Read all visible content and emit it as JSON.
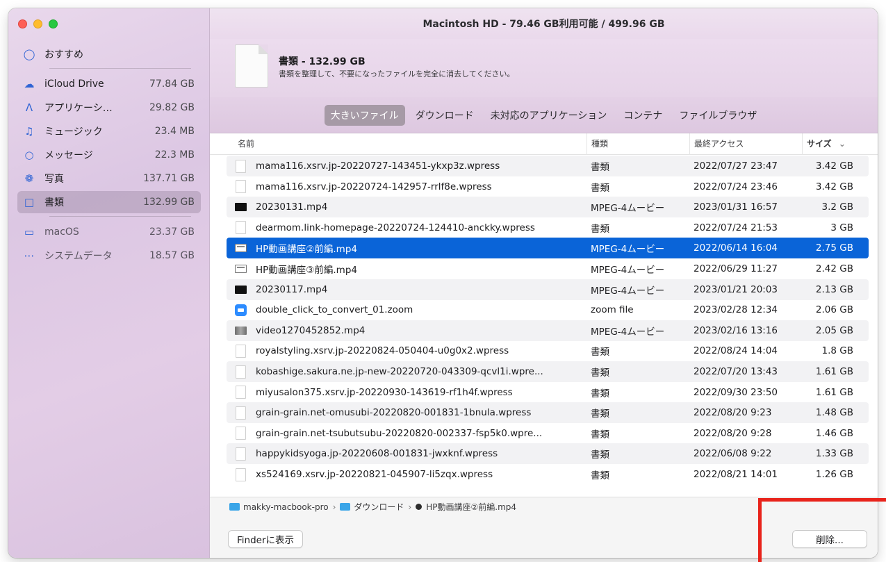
{
  "window": {
    "title": "Macintosh HD - 79.46 GB利用可能 / 499.96 GB"
  },
  "sidebar": {
    "items": [
      {
        "icon": "lightbulb-icon",
        "label": "おすすめ",
        "size": ""
      },
      {
        "icon": "cloud-icon",
        "label": "iCloud Drive",
        "size": "77.84 GB"
      },
      {
        "icon": "apps-icon",
        "label": "アプリケーシ…",
        "size": "29.82 GB"
      },
      {
        "icon": "music-note-icon",
        "label": "ミュージック",
        "size": "23.4 MB"
      },
      {
        "icon": "message-bubble-icon",
        "label": "メッセージ",
        "size": "22.3 MB"
      },
      {
        "icon": "photos-flower-icon",
        "label": "写真",
        "size": "137.71 GB"
      },
      {
        "icon": "document-icon",
        "label": "書類",
        "size": "132.99 GB"
      },
      {
        "icon": "laptop-icon",
        "label": "macOS",
        "size": "23.37 GB"
      },
      {
        "icon": "ellipsis-icon",
        "label": "システムデータ",
        "size": "18.57 GB"
      }
    ]
  },
  "header": {
    "title": "書類 - 132.99 GB",
    "description": "書類を整理して、不要になったファイルを完全に消去してください。"
  },
  "tabs": [
    {
      "label": "大きいファイル",
      "active": true
    },
    {
      "label": "ダウンロード",
      "active": false
    },
    {
      "label": "未対応のアプリケーション",
      "active": false
    },
    {
      "label": "コンテナ",
      "active": false
    },
    {
      "label": "ファイルブラウザ",
      "active": false
    }
  ],
  "table": {
    "columns": {
      "name": "名前",
      "kind": "種類",
      "last_access": "最終アクセス",
      "size": "サイズ"
    },
    "sort_indicator": "⌄",
    "rows": [
      {
        "icon": "doc",
        "name": "mama116.xsrv.jp-20220727-143451-ykxp3z.wpress",
        "kind": "書類",
        "date": "2022/07/27 23:47",
        "size": "3.42 GB"
      },
      {
        "icon": "doc",
        "name": "mama116.xsrv.jp-20220724-142957-rrlf8e.wpress",
        "kind": "書類",
        "date": "2022/07/24 23:46",
        "size": "3.42 GB"
      },
      {
        "icon": "video",
        "name": "20230131.mp4",
        "kind": "MPEG-4ムービー",
        "date": "2023/01/31 16:57",
        "size": "3.2 GB"
      },
      {
        "icon": "doc",
        "name": "dearmom.link-homepage-20220724-124410-anckky.wpress",
        "kind": "書類",
        "date": "2022/07/24 21:53",
        "size": "3 GB"
      },
      {
        "icon": "video-light",
        "name": "HP動画講座②前編.mp4",
        "kind": "MPEG-4ムービー",
        "date": "2022/06/14 16:04",
        "size": "2.75 GB",
        "selected": true
      },
      {
        "icon": "video-light",
        "name": "HP動画講座③前編.mp4",
        "kind": "MPEG-4ムービー",
        "date": "2022/06/29 11:27",
        "size": "2.42 GB"
      },
      {
        "icon": "video",
        "name": "20230117.mp4",
        "kind": "MPEG-4ムービー",
        "date": "2023/01/21 20:03",
        "size": "2.13 GB"
      },
      {
        "icon": "zoom",
        "name": "double_click_to_convert_01.zoom",
        "kind": "zoom file",
        "date": "2023/02/28 12:34",
        "size": "2.06 GB"
      },
      {
        "icon": "video-gray",
        "name": "video1270452852.mp4",
        "kind": "MPEG-4ムービー",
        "date": "2023/02/16 13:16",
        "size": "2.05 GB"
      },
      {
        "icon": "doc",
        "name": "royalstyling.xsrv.jp-20220824-050404-u0g0x2.wpress",
        "kind": "書類",
        "date": "2022/08/24 14:04",
        "size": "1.8 GB"
      },
      {
        "icon": "doc",
        "name": "kobashige.sakura.ne.jp-new-20220720-043309-qcvl1i.wpre...",
        "kind": "書類",
        "date": "2022/07/20 13:43",
        "size": "1.61 GB"
      },
      {
        "icon": "doc",
        "name": "miyusalon375.xsrv.jp-20220930-143619-rf1h4f.wpress",
        "kind": "書類",
        "date": "2022/09/30 23:50",
        "size": "1.61 GB"
      },
      {
        "icon": "doc",
        "name": "grain-grain.net-omusubi-20220820-001831-1bnula.wpress",
        "kind": "書類",
        "date": "2022/08/20 9:23",
        "size": "1.48 GB"
      },
      {
        "icon": "doc",
        "name": "grain-grain.net-tsubutsubu-20220820-002337-fsp5k0.wpre...",
        "kind": "書類",
        "date": "2022/08/20 9:28",
        "size": "1.46 GB"
      },
      {
        "icon": "doc",
        "name": "happykidsyoga.jp-20220608-001831-jwxknf.wpress",
        "kind": "書類",
        "date": "2022/06/08 9:22",
        "size": "1.33 GB"
      },
      {
        "icon": "doc",
        "name": "xs524169.xsrv.jp-20220821-045907-li5zqx.wpress",
        "kind": "書類",
        "date": "2022/08/21 14:01",
        "size": "1.26 GB"
      }
    ]
  },
  "pathbar": {
    "segments": [
      "makky-macbook-pro",
      "ダウンロード",
      "HP動画講座②前編.mp4"
    ],
    "separator": "›"
  },
  "footer": {
    "finder_button": "Finderに表示",
    "delete_button": "削除..."
  },
  "colors": {
    "selection": "#0a64d8",
    "highlight_box": "#e8231b",
    "sidebar_icon": "#2f64d4"
  }
}
